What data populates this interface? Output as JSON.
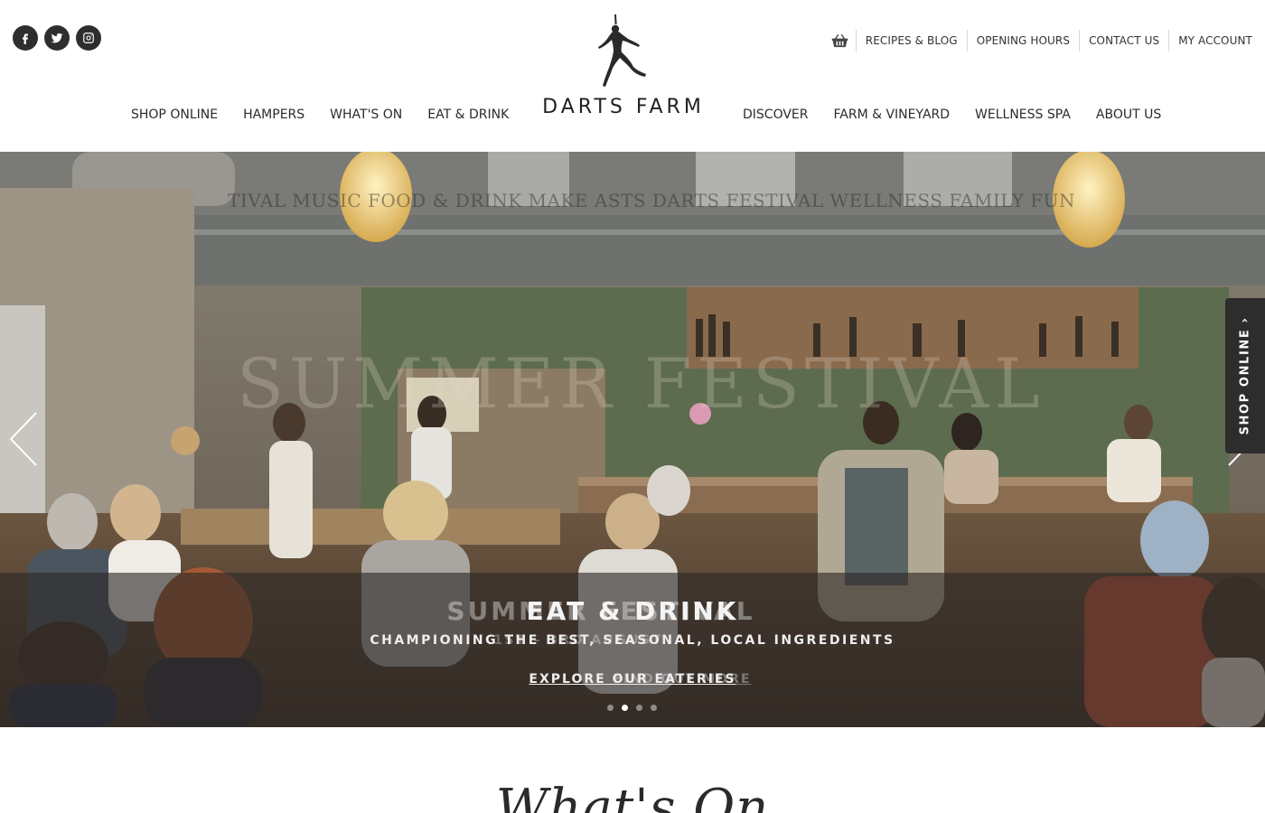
{
  "social": {
    "icons": [
      "facebook-icon",
      "twitter-icon",
      "instagram-icon"
    ]
  },
  "utility_nav": {
    "basket_icon": "basket-icon",
    "links": [
      "RECIPES & BLOG",
      "OPENING HOURS",
      "CONTACT US",
      "MY ACCOUNT"
    ]
  },
  "logo": {
    "text": "DARTS FARM",
    "icon": "dancer-logo-icon"
  },
  "main_nav": {
    "left": [
      "SHOP ONLINE",
      "HAMPERS",
      "WHAT'S ON",
      "EAT & DRINK"
    ],
    "right": [
      "DISCOVER",
      "FARM & VINEYARD",
      "WELLNESS SPA",
      "ABOUT US"
    ]
  },
  "hero": {
    "background_strip": "TIVAL MUSIC FOOD & DRINK  MAKE  ASTS  DARTS FESTIVAL  WELLNESS  FAMILY FUN",
    "background_big": "SUMMER FESTIVAL",
    "slide": {
      "title_ghost": "SUMMER FESTIVAL",
      "title": "EAT & DRINK",
      "subtitle_ghost": "1ST – 3RD AUGUST",
      "subtitle": "CHAMPIONING THE BEST, SEASONAL, LOCAL INGREDIENTS",
      "link_ghost": "FIND OUT MORE",
      "link": "EXPLORE OUR EATERIES"
    },
    "shop_tab": "SHOP ONLINE ›",
    "dots": {
      "count": 4,
      "active_index": 1
    }
  },
  "section": {
    "heading": "What's On"
  },
  "colors": {
    "header_bg": "#ffffff",
    "text_dark": "#2b2b2b",
    "tab_bg": "#2d2d2d",
    "caption_band": "rgba(45,40,38,0.62)"
  }
}
